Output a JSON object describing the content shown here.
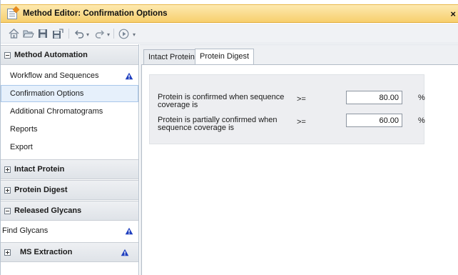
{
  "window": {
    "title": "Method Editor: Confirmation Options",
    "close_label": "×"
  },
  "toolbar": {
    "buttons": [
      {
        "icon": "home-icon"
      },
      {
        "icon": "open-folder-icon"
      },
      {
        "icon": "save-icon"
      },
      {
        "icon": "save-as-icon"
      },
      {
        "icon": "undo-icon"
      },
      {
        "icon": "redo-icon"
      },
      {
        "icon": "run-icon"
      }
    ],
    "dropdown_glyph": "▾"
  },
  "sidebar": {
    "groups": [
      {
        "label": "Method Automation",
        "expanded": true,
        "items": [
          {
            "label": "Workflow and Sequences",
            "warning": true
          },
          {
            "label": "Confirmation Options",
            "selected": true
          },
          {
            "label": "Additional Chromatograms"
          },
          {
            "label": "Reports"
          },
          {
            "label": "Export"
          }
        ]
      },
      {
        "label": "Intact Protein",
        "expanded": false
      },
      {
        "label": "Protein Digest",
        "expanded": false
      },
      {
        "label": "Released Glycans",
        "expanded": true,
        "items": [
          {
            "label": "Find Glycans",
            "warning": true
          }
        ]
      },
      {
        "label": "MS Extraction",
        "expanded": false,
        "warning": true
      }
    ]
  },
  "tabs": [
    {
      "label": "Intact Protein",
      "active": false
    },
    {
      "label": "Protein Digest",
      "active": true
    }
  ],
  "confirmation": {
    "rows": [
      {
        "label": "Protein is confirmed when sequence coverage is",
        "operator": ">=",
        "value": "80.00",
        "unit": "%"
      },
      {
        "label": "Protein is partially confirmed when sequence coverage is",
        "operator": ">=",
        "value": "60.00",
        "unit": "%"
      }
    ]
  },
  "colors": {
    "title_bar": "#f7cf6d",
    "warning_icon": "#1f3fbf",
    "selection": "#e6f0fb"
  }
}
